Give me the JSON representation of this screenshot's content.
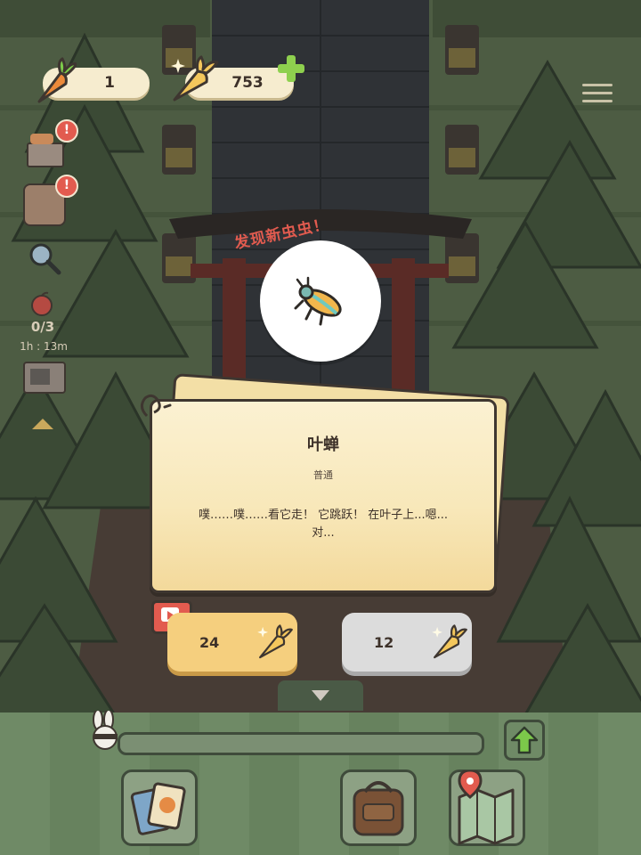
{
  "hud": {
    "carrot_count": "1",
    "golden_carrot_count": "753",
    "timer_fraction": "0/3",
    "timer_remaining": "1h : 13m"
  },
  "discovery": {
    "label": "发现新虫虫！",
    "bug_icon": "leafhopper-icon"
  },
  "card": {
    "title": "叶蝉",
    "rarity": "普通",
    "description": "噗……噗……看它走！ 它跳跃！ 在叶子上...嗯...对..."
  },
  "purchase": {
    "ad_price": "24",
    "coin_price": "12",
    "ad_icon": "video-ad-icon",
    "currency_icon": "golden-carrot-icon"
  },
  "bottom": {
    "progress": 0.0,
    "tools": [
      "cards-icon",
      "backpack-icon",
      "map-icon"
    ],
    "upgrade_icon": "green-up-arrow-icon"
  },
  "colors": {
    "accent_red": "#e25b4f",
    "buy_primary": "#f5cf7e",
    "buy_secondary": "#dcdcdc",
    "card_bg": "#fbf1d2"
  }
}
